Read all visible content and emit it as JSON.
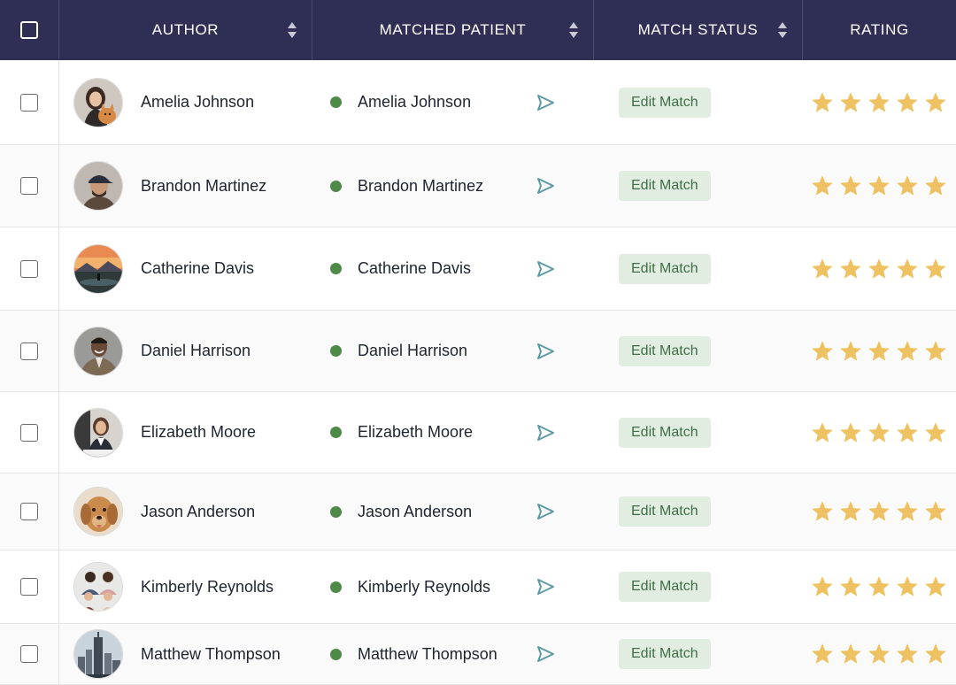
{
  "header": {
    "author": "AUTHOR",
    "matched_patient": "MATCHED PATIENT",
    "match_status": "MATCH STATUS",
    "rating": "RATING"
  },
  "rows": [
    {
      "author": "Amelia Johnson",
      "patient": "Amelia Johnson",
      "button": "Edit Match",
      "rating": 5,
      "avatar": "woman-with-cat"
    },
    {
      "author": "Brandon Martinez",
      "patient": "Brandon Martinez",
      "button": "Edit Match",
      "rating": 5,
      "avatar": "man-with-cap"
    },
    {
      "author": "Catherine Davis",
      "patient": "Catherine Davis",
      "button": "Edit Match",
      "rating": 5,
      "avatar": "sunset-landscape"
    },
    {
      "author": "Daniel Harrison",
      "patient": "Daniel Harrison",
      "button": "Edit Match",
      "rating": 5,
      "avatar": "man-in-suit"
    },
    {
      "author": "Elizabeth Moore",
      "patient": "Elizabeth Moore",
      "button": "Edit Match",
      "rating": 5,
      "avatar": "woman-at-desk"
    },
    {
      "author": "Jason Anderson",
      "patient": "Jason Anderson",
      "button": "Edit Match",
      "rating": 5,
      "avatar": "golden-retriever"
    },
    {
      "author": "Kimberly Reynolds",
      "patient": "Kimberly Reynolds",
      "button": "Edit Match",
      "rating": 5,
      "avatar": "family-group"
    },
    {
      "author": "Matthew Thompson",
      "patient": "Matthew Thompson",
      "button": "Edit Match",
      "rating": 5,
      "avatar": "city-skyline"
    }
  ],
  "colors": {
    "header_bg": "#2f2f55",
    "status_dot": "#4e8a47",
    "button_bg": "#e2ede1",
    "button_text": "#3f6e46",
    "star": "#eec262",
    "send_icon": "#5f9aa3"
  }
}
